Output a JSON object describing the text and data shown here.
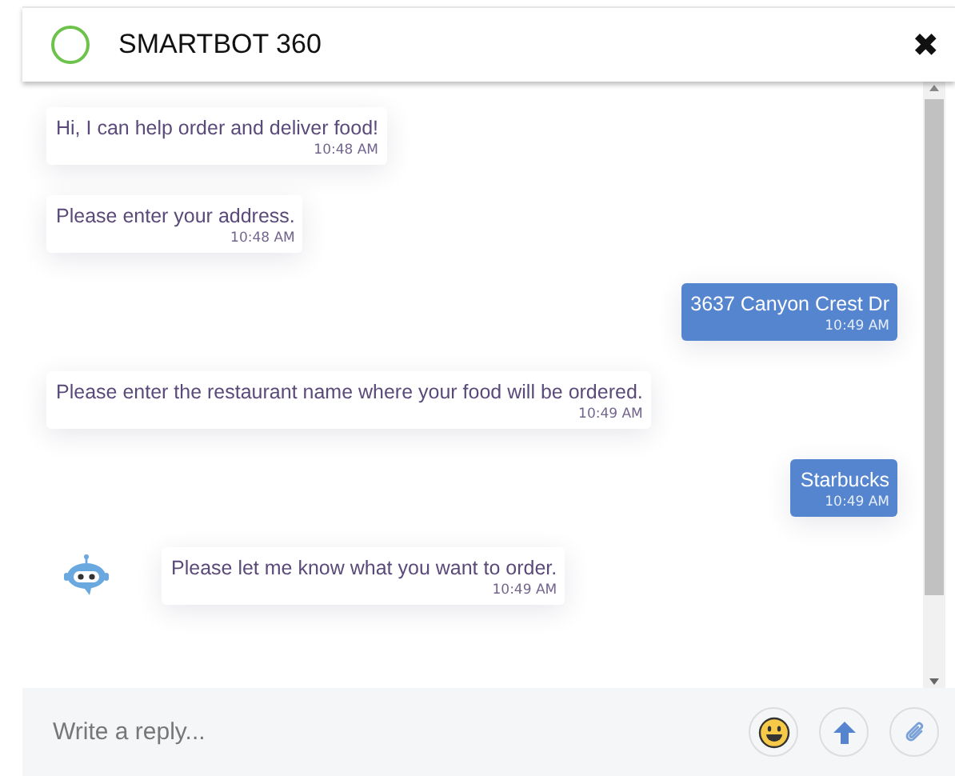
{
  "header": {
    "title": "SMARTBOT 360",
    "close": "✖"
  },
  "messages": [
    {
      "kind": "bot",
      "text": "Hi, I can help order and deliver food!",
      "time": "10:48 AM",
      "avatar": false
    },
    {
      "kind": "bot",
      "text": "Please enter your address.",
      "time": "10:48 AM",
      "avatar": false
    },
    {
      "kind": "user",
      "text": "3637 Canyon Crest Dr",
      "time": "10:49 AM",
      "avatar": false
    },
    {
      "kind": "bot",
      "text": "Please enter the restaurant name where your food will be ordered.",
      "time": "10:49 AM",
      "avatar": false
    },
    {
      "kind": "user",
      "text": "Starbucks",
      "time": "10:49 AM",
      "avatar": false
    },
    {
      "kind": "bot",
      "text": "Please let me know what you want to order.",
      "time": "10:49 AM",
      "avatar": true
    }
  ],
  "composer": {
    "placeholder": "Write a reply..."
  }
}
